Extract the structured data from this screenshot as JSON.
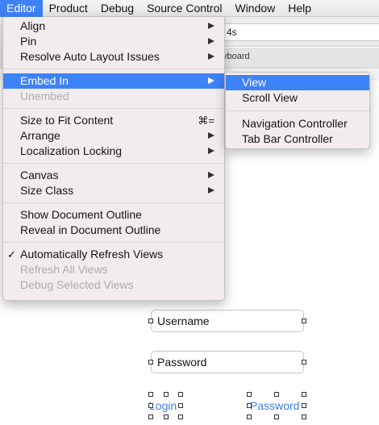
{
  "menubar": {
    "items": [
      "Editor",
      "Product",
      "Debug",
      "Source Control",
      "Window",
      "Help"
    ],
    "active": "Editor"
  },
  "background": {
    "device_field": "4s",
    "crumb": "yboard"
  },
  "editor_menu": {
    "align": "Align",
    "pin": "Pin",
    "resolve": "Resolve Auto Layout Issues",
    "embed_in": "Embed In",
    "unembed": "Unembed",
    "size_to_fit": "Size to Fit Content",
    "size_to_fit_shortcut": "⌘=",
    "arrange": "Arrange",
    "localization_locking": "Localization Locking",
    "canvas": "Canvas",
    "size_class": "Size Class",
    "show_outline": "Show Document Outline",
    "reveal_outline": "Reveal in Document Outline",
    "auto_refresh": "Automatically Refresh Views",
    "auto_refresh_check": "✓",
    "refresh_all": "Refresh All Views",
    "debug_selected": "Debug Selected Views"
  },
  "embed_submenu": {
    "view": "View",
    "scroll_view": "Scroll View",
    "navigation_controller": "Navigation Controller",
    "tab_bar_controller": "Tab Bar Controller"
  },
  "storyboard": {
    "username_field": "Username",
    "password_field": "Password",
    "login_button": "Login",
    "password_button": "Password"
  },
  "colors": {
    "highlight": "#3e82f7",
    "link": "#3e7fd9"
  }
}
